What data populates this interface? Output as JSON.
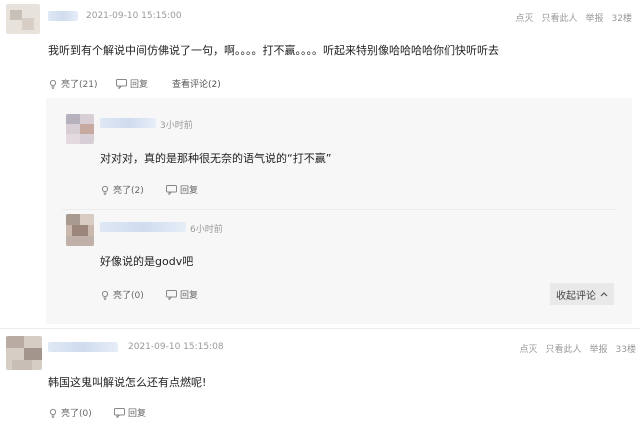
{
  "comments": [
    {
      "time": "2021-09-10 15:15:00",
      "actions_right": [
        "点灭",
        "只看此人",
        "举报",
        "32楼"
      ],
      "text": "我听到有个解说中间仿佛说了一句，啊。。。。打不赢。。。。听起来特别像哈哈哈哈你们快听听去",
      "like_label": "亮了(21)",
      "reply_label": "回复",
      "view_replies_label": "查看评论(2)",
      "replies": [
        {
          "time": "3小时前",
          "text": "对对对，真的是那种很无奈的语气说的“打不赢”",
          "like_label": "亮了(2)",
          "reply_label": "回复"
        },
        {
          "time": "6小时前",
          "text": "好像说的是godv吧",
          "like_label": "亮了(0)",
          "reply_label": "回复",
          "collapse_label": "收起评论"
        }
      ]
    },
    {
      "time": "2021-09-10 15:15:08",
      "actions_right": [
        "点灭",
        "只看此人",
        "举报",
        "33楼"
      ],
      "text": "韩国这鬼叫解说怎么还有点燃呢!",
      "like_label": "亮了(0)",
      "reply_label": "回复"
    }
  ],
  "icons": [
    "like-icon",
    "reply-icon",
    "chevron-up-icon"
  ]
}
